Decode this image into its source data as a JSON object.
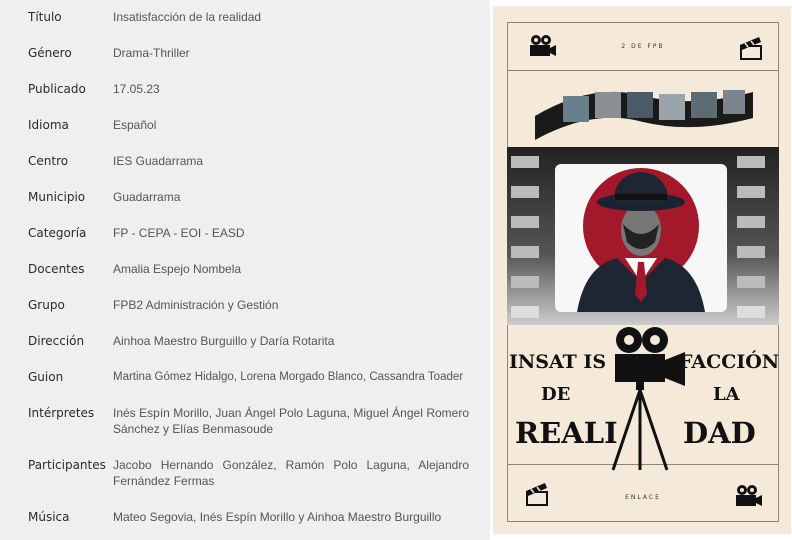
{
  "details": [
    {
      "label": "Título",
      "value": "Insatisfacción de la realidad"
    },
    {
      "label": "Género",
      "value": "Drama-Thriller"
    },
    {
      "label": "Publicado",
      "value": "17.05.23"
    },
    {
      "label": "Idioma",
      "value": "Español"
    },
    {
      "label": "Centro",
      "value": "IES Guadarrama"
    },
    {
      "label": "Municipio",
      "value": "Guadarrama"
    },
    {
      "label": "Categoría",
      "value": "FP - CEPA - EOI - EASD"
    },
    {
      "label": "Docentes",
      "value": "Amalia Espejo Nombela"
    },
    {
      "label": "Grupo",
      "value": "FPB2 Administración y Gestión"
    },
    {
      "label": "Dirección",
      "value": "Ainhoa Maestro Burguillo y Daría Rotarita"
    },
    {
      "label": "Guion",
      "value": "Martina Gómez Hidalgo, Lorena Morgado Blanco, Cassandra Toader"
    },
    {
      "label": "Intérpretes",
      "value": "Inés Espín Morillo, Juan Ángel Polo Laguna, Miguel Ángel Romero Sánchez y Elías Benmasoude"
    },
    {
      "label": "Participantes",
      "value": "Jacobo Hernando González, Ramón Polo Laguna, Alejandro Fernández Fermas"
    },
    {
      "label": "Música",
      "value": "Mateo Segovia, Inés Espín Morillo y Ainhoa Maestro Burguillo"
    }
  ],
  "poster": {
    "top_text": "2 DE FPB",
    "bottom_text": "ENLACE",
    "title_l1a": "INSAT IS",
    "title_l1b": "FACCIÓN",
    "title_l2a": "DE",
    "title_l2b": "LA",
    "title_l3a": "REALI",
    "title_l3b": "DAD"
  }
}
